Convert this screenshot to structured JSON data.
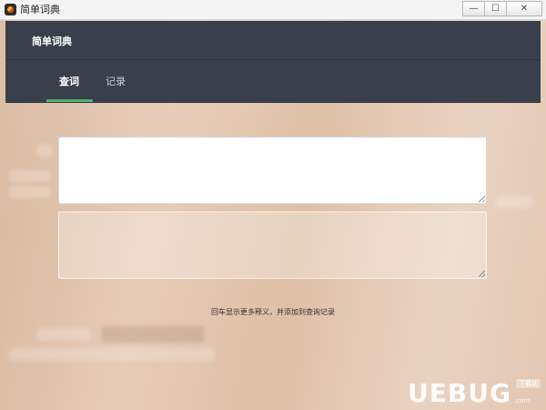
{
  "window": {
    "title": "简单词典",
    "controls": {
      "minimize": "—",
      "maximize": "☐",
      "close": "✕"
    }
  },
  "header": {
    "title": "简单词典"
  },
  "tabs": [
    {
      "label": "查词",
      "active": true
    },
    {
      "label": "记录",
      "active": false
    }
  ],
  "query": {
    "input_value": "",
    "output_value": ""
  },
  "hint": "回车显示更多释义，并添加到查询记录",
  "watermark": {
    "logo": "UEBUG",
    "badge": "下载站",
    "domain": ".com"
  },
  "colors": {
    "header_bg": "#3a3f4c",
    "active_tab_indicator": "#4cb36a"
  }
}
